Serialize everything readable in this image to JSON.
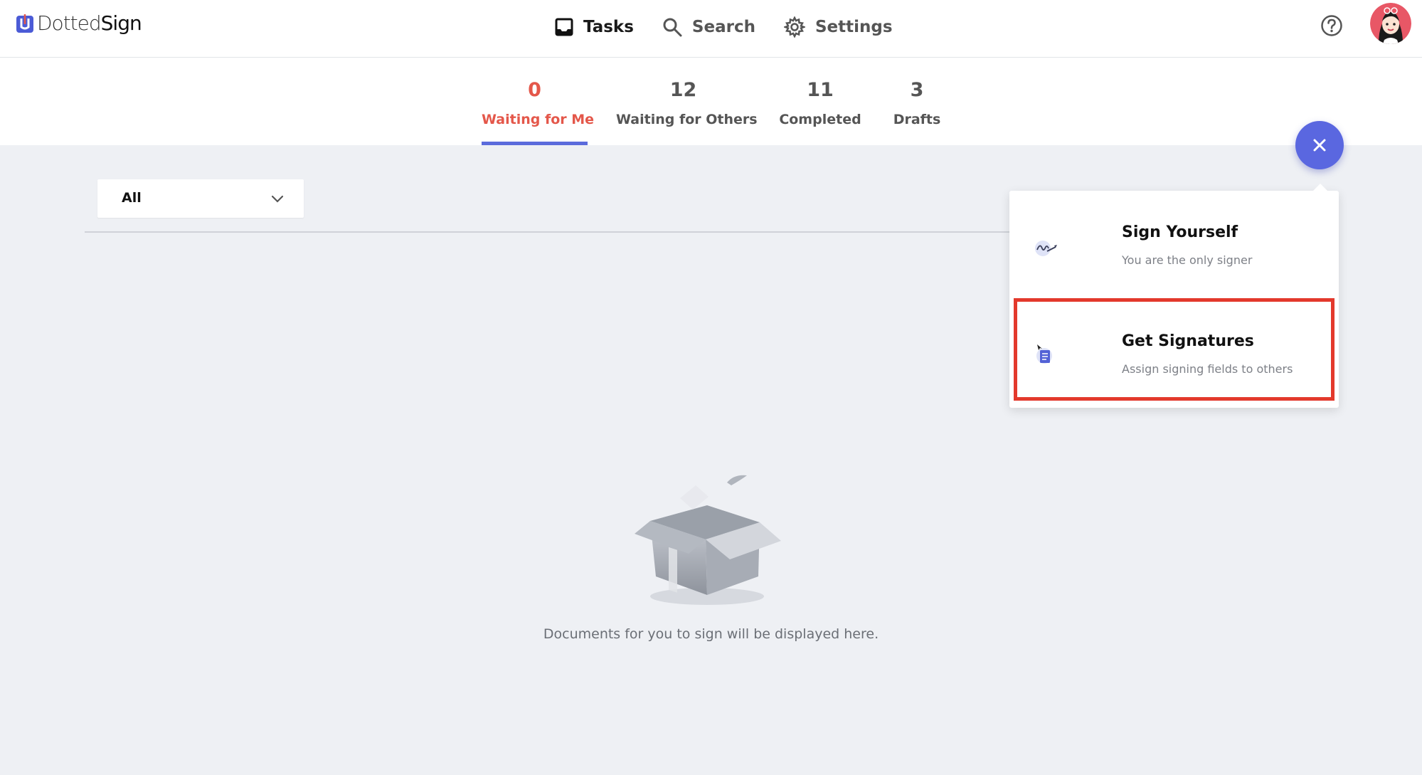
{
  "header": {
    "logo": {
      "text_light": "Dotted",
      "text_bold": "Sign"
    },
    "nav": [
      {
        "label": "Tasks",
        "icon": "inbox-icon"
      },
      {
        "label": "Search",
        "icon": "search-icon"
      },
      {
        "label": "Settings",
        "icon": "gear-icon"
      }
    ],
    "help_icon": "help-circle-icon",
    "avatar": "user-avatar"
  },
  "tabs": [
    {
      "count": "0",
      "label": "Waiting for Me",
      "active": true
    },
    {
      "count": "12",
      "label": "Waiting for Others"
    },
    {
      "count": "11",
      "label": "Completed"
    },
    {
      "count": "3",
      "label": "Drafts"
    }
  ],
  "filter": {
    "value": "All"
  },
  "empty_state": {
    "message": "Documents for you to sign will be displayed here."
  },
  "fab": {
    "icon": "close-icon"
  },
  "popup_menu": [
    {
      "title": "Sign Yourself",
      "subtitle": "You are the only signer",
      "icon": "pen-signature-icon"
    },
    {
      "title": "Get Signatures",
      "subtitle": "Assign signing fields to others",
      "icon": "document-send-icon",
      "highlighted": true
    }
  ],
  "colors": {
    "accent": "#5a67e0",
    "active_tab_text": "#e4574a",
    "highlight_border": "#e3392c",
    "background": "#eef0f4"
  }
}
